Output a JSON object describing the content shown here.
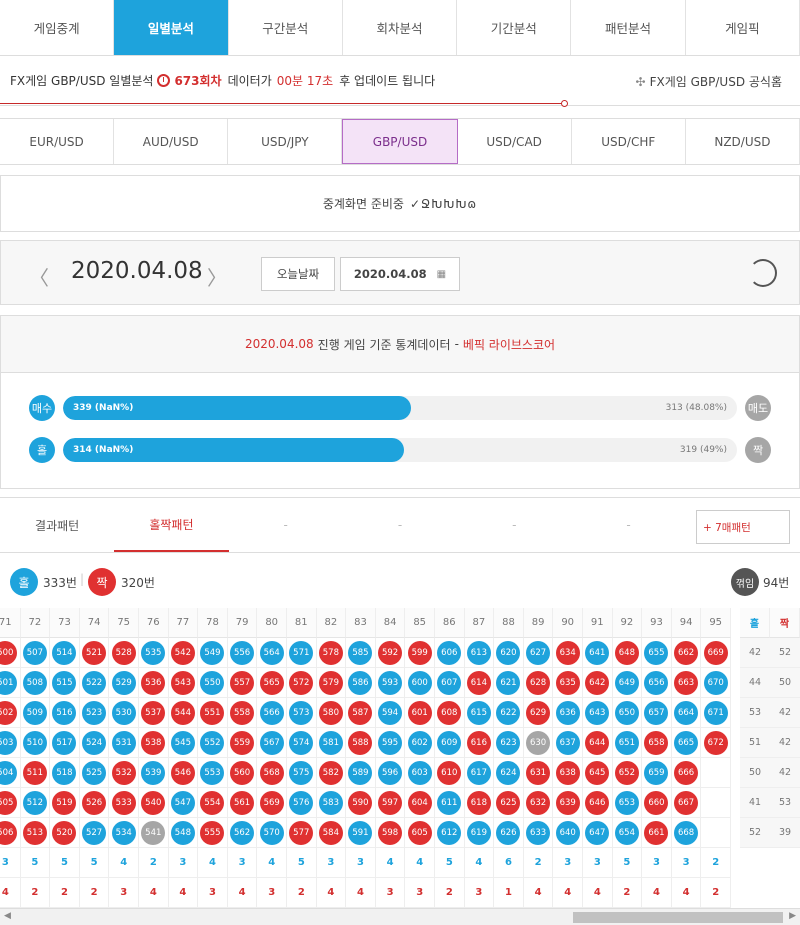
{
  "colors": {
    "blue": "#1ea3dc",
    "red": "#e03131",
    "gray": "#a6a6a6",
    "accent_red": "#d32f2f",
    "purple": "#7b2e8c"
  },
  "top_tabs": [
    "게임중계",
    "일별분석",
    "구간분석",
    "회차분석",
    "기간분석",
    "패턴분석",
    "게임픽"
  ],
  "top_tab_active": 1,
  "info": {
    "prefix": "FX게임 GBP/USD 일별분석",
    "round": "673회차",
    "mid": "데이터가",
    "time": "00분 17초",
    "suffix": "후 업데이트 됩니다",
    "official": "FX게임 GBP/USD 공식홈",
    "clock_icon": "clock-icon",
    "link_icon": "fx-link-icon"
  },
  "currencies": [
    "EUR/USD",
    "AUD/USD",
    "USD/JPY",
    "GBP/USD",
    "USD/CAD",
    "USD/CHF",
    "NZD/USD"
  ],
  "currency_active": 3,
  "live": {
    "text": "중계화면 준비중",
    "loader": "✓ՋԽԽԽɷ"
  },
  "date_nav": {
    "date": "2020.04.08",
    "today_label": "오늘날짜",
    "picker_value": "2020.04.08",
    "prev_icon": "chevron-left-icon",
    "next_icon": "chevron-right-icon",
    "refresh_icon": "refresh-icon"
  },
  "stats": {
    "date": "2020.04.08",
    "text": "진행 게임 기준 통계데이터",
    "dash": "-",
    "brand": "베픽 라이브스코어",
    "rows": [
      {
        "left_label": "매수",
        "right_label": "매도",
        "left_text": "339 (NaN%)",
        "right_text": "313 (48.08%)",
        "fill_pct": 51.7
      },
      {
        "left_label": "홀",
        "right_label": "짝",
        "left_text": "314 (NaN%)",
        "right_text": "319 (49%)",
        "fill_pct": 50.6
      }
    ]
  },
  "pattern_tabs": [
    "결과패턴",
    "홀짝패턴",
    "-",
    "-",
    "-",
    "-"
  ],
  "pattern_tab_active": 1,
  "pattern_button": "+ 7매패턴",
  "summary": {
    "odd_label": "홀",
    "odd_count": "333번",
    "even_label": "짝",
    "even_count": "320번",
    "break_label": "꺾임",
    "break_count": "94번"
  },
  "grid": {
    "col_numbers": [
      "71",
      "72",
      "73",
      "74",
      "75",
      "76",
      "77",
      "78",
      "79",
      "80",
      "81",
      "82",
      "83",
      "84",
      "85",
      "86",
      "87",
      "88",
      "89",
      "90",
      "91",
      "92",
      "93",
      "94",
      "95"
    ],
    "odd_header": "홀",
    "even_header": "짝",
    "start_numbers": [
      500,
      507,
      514,
      521,
      528,
      535,
      542,
      549,
      556,
      564,
      571,
      578,
      585,
      592,
      599,
      606,
      613,
      620,
      627,
      634,
      641,
      648,
      655,
      662,
      669
    ],
    "col_lengths": [
      7,
      7,
      7,
      7,
      7,
      7,
      7,
      7,
      7,
      7,
      7,
      7,
      7,
      7,
      7,
      7,
      7,
      7,
      7,
      7,
      7,
      7,
      7,
      7,
      4
    ],
    "rows": [
      "RBBRRBRBBBBRBRRBBBBRBRBRR",
      "BBBBBRRBRRRRBBBBRBRRRBBRB",
      "RBBBBRRRRBBRRBRRBBRBBBBBB",
      "BBBBBRBBRBBBRBBBRBGBRBRBR",
      "BRBBRBRBRRBRBBBRBBRRRRBR ",
      "RBRRRRBRRRBBRRRBRRRRRBRR ",
      "RRRBBGBRBBRRBRRBBBBBBBRB "
    ],
    "row_odd_totals": [
      "42",
      "44",
      "53",
      "51",
      "50",
      "41",
      "52"
    ],
    "row_even_totals": [
      "52",
      "50",
      "42",
      "42",
      "42",
      "53",
      "39"
    ],
    "count_blue": [
      "3",
      "5",
      "5",
      "5",
      "4",
      "2",
      "3",
      "4",
      "3",
      "4",
      "5",
      "3",
      "3",
      "4",
      "4",
      "5",
      "4",
      "6",
      "2",
      "3",
      "3",
      "5",
      "3",
      "3",
      "2"
    ],
    "count_red": [
      "4",
      "2",
      "2",
      "2",
      "3",
      "4",
      "4",
      "3",
      "4",
      "3",
      "2",
      "4",
      "4",
      "3",
      "3",
      "2",
      "3",
      "1",
      "4",
      "4",
      "4",
      "2",
      "4",
      "4",
      "2"
    ]
  }
}
